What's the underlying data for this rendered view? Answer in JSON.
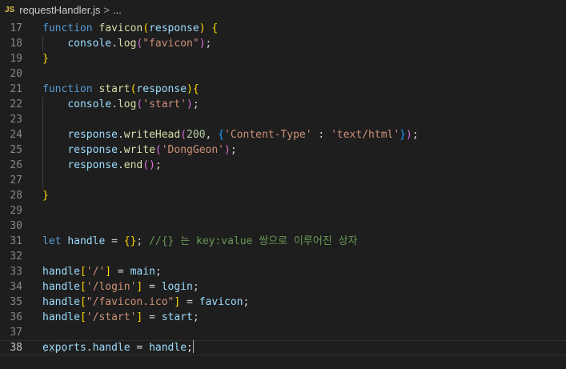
{
  "breadcrumb": {
    "file_icon": "JS",
    "file_name": "requestHandler.js",
    "separator": ">",
    "ellipsis": "..."
  },
  "editor": {
    "current_line": 38,
    "colors": {
      "background": "#1e1e1e",
      "keyword": "#569cd6",
      "function": "#dcdcaa",
      "variable": "#9cdcfe",
      "string": "#ce9178",
      "number": "#b5cea8",
      "comment": "#6a9955"
    },
    "lines": [
      {
        "n": "17",
        "tokens": [
          [
            "kw",
            "function"
          ],
          [
            "plain",
            " "
          ],
          [
            "fn",
            "favicon"
          ],
          [
            "br1",
            "("
          ],
          [
            "var",
            "response"
          ],
          [
            "br1",
            ")"
          ],
          [
            "plain",
            " "
          ],
          [
            "br1",
            "{"
          ]
        ]
      },
      {
        "n": "18",
        "tokens": [
          [
            "plain",
            "    "
          ],
          [
            "var",
            "console"
          ],
          [
            "plain",
            "."
          ],
          [
            "fn",
            "log"
          ],
          [
            "br2",
            "("
          ],
          [
            "str",
            "\"favicon\""
          ],
          [
            "br2",
            ")"
          ],
          [
            "plain",
            ";"
          ]
        ]
      },
      {
        "n": "19",
        "tokens": [
          [
            "br1",
            "}"
          ]
        ]
      },
      {
        "n": "20",
        "tokens": []
      },
      {
        "n": "21",
        "tokens": [
          [
            "kw",
            "function"
          ],
          [
            "plain",
            " "
          ],
          [
            "fn",
            "start"
          ],
          [
            "br1",
            "("
          ],
          [
            "var",
            "response"
          ],
          [
            "br1",
            ")"
          ],
          [
            "br1",
            "{"
          ]
        ]
      },
      {
        "n": "22",
        "tokens": [
          [
            "plain",
            "    "
          ],
          [
            "var",
            "console"
          ],
          [
            "plain",
            "."
          ],
          [
            "fn",
            "log"
          ],
          [
            "br2",
            "("
          ],
          [
            "str",
            "'start'"
          ],
          [
            "br2",
            ")"
          ],
          [
            "plain",
            ";"
          ]
        ]
      },
      {
        "n": "23",
        "tokens": []
      },
      {
        "n": "24",
        "tokens": [
          [
            "plain",
            "    "
          ],
          [
            "var",
            "response"
          ],
          [
            "plain",
            "."
          ],
          [
            "fn",
            "writeHead"
          ],
          [
            "br2",
            "("
          ],
          [
            "num",
            "200"
          ],
          [
            "plain",
            ", "
          ],
          [
            "br3",
            "{"
          ],
          [
            "str",
            "'Content-Type'"
          ],
          [
            "plain",
            " : "
          ],
          [
            "str",
            "'text/html'"
          ],
          [
            "br3",
            "}"
          ],
          [
            "br2",
            ")"
          ],
          [
            "plain",
            ";"
          ]
        ]
      },
      {
        "n": "25",
        "tokens": [
          [
            "plain",
            "    "
          ],
          [
            "var",
            "response"
          ],
          [
            "plain",
            "."
          ],
          [
            "fn",
            "write"
          ],
          [
            "br2",
            "("
          ],
          [
            "str",
            "'DongGeon'"
          ],
          [
            "br2",
            ")"
          ],
          [
            "plain",
            ";"
          ]
        ]
      },
      {
        "n": "26",
        "tokens": [
          [
            "plain",
            "    "
          ],
          [
            "var",
            "response"
          ],
          [
            "plain",
            "."
          ],
          [
            "fn",
            "end"
          ],
          [
            "br2",
            "("
          ],
          [
            "br2",
            ")"
          ],
          [
            "plain",
            ";"
          ]
        ]
      },
      {
        "n": "27",
        "tokens": []
      },
      {
        "n": "28",
        "tokens": [
          [
            "br1",
            "}"
          ]
        ]
      },
      {
        "n": "29",
        "tokens": []
      },
      {
        "n": "30",
        "tokens": []
      },
      {
        "n": "31",
        "tokens": [
          [
            "kw",
            "let"
          ],
          [
            "plain",
            " "
          ],
          [
            "var",
            "handle"
          ],
          [
            "plain",
            " = "
          ],
          [
            "br1",
            "{}"
          ],
          [
            "plain",
            "; "
          ],
          [
            "cm",
            "//{} 는 key:value 쌍으로 이루어진 상자"
          ]
        ]
      },
      {
        "n": "32",
        "tokens": []
      },
      {
        "n": "33",
        "tokens": [
          [
            "var",
            "handle"
          ],
          [
            "br1",
            "["
          ],
          [
            "str",
            "'/'"
          ],
          [
            "br1",
            "]"
          ],
          [
            "plain",
            " = "
          ],
          [
            "var",
            "main"
          ],
          [
            "plain",
            ";"
          ]
        ]
      },
      {
        "n": "34",
        "tokens": [
          [
            "var",
            "handle"
          ],
          [
            "br1",
            "["
          ],
          [
            "str",
            "'/login'"
          ],
          [
            "br1",
            "]"
          ],
          [
            "plain",
            " = "
          ],
          [
            "var",
            "login"
          ],
          [
            "plain",
            ";"
          ]
        ]
      },
      {
        "n": "35",
        "tokens": [
          [
            "var",
            "handle"
          ],
          [
            "br1",
            "["
          ],
          [
            "str",
            "\"/favicon.ico\""
          ],
          [
            "br1",
            "]"
          ],
          [
            "plain",
            " = "
          ],
          [
            "var",
            "favicon"
          ],
          [
            "plain",
            ";"
          ]
        ]
      },
      {
        "n": "36",
        "tokens": [
          [
            "var",
            "handle"
          ],
          [
            "br1",
            "["
          ],
          [
            "str",
            "'/start'"
          ],
          [
            "br1",
            "]"
          ],
          [
            "plain",
            " = "
          ],
          [
            "var",
            "start"
          ],
          [
            "plain",
            ";"
          ]
        ]
      },
      {
        "n": "37",
        "tokens": []
      },
      {
        "n": "38",
        "tokens": [
          [
            "var",
            "exports"
          ],
          [
            "plain",
            "."
          ],
          [
            "var",
            "handle"
          ],
          [
            "plain",
            " = "
          ],
          [
            "var",
            "handle"
          ],
          [
            "plain",
            ";"
          ]
        ]
      }
    ]
  }
}
